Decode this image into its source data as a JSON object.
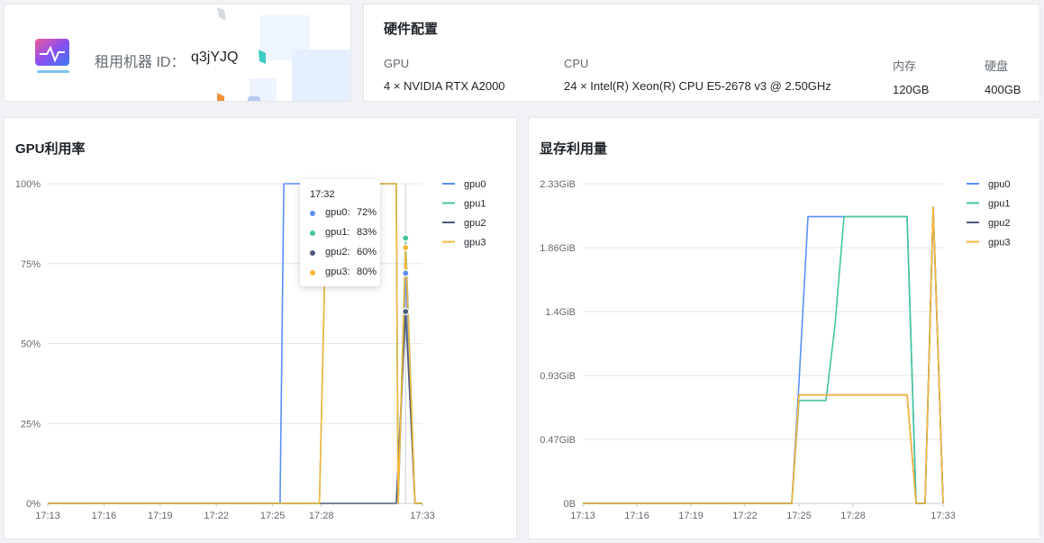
{
  "machine": {
    "label": "租用机器 ID：",
    "id": "q3jYJQ"
  },
  "hardware": {
    "title": "硬件配置",
    "columns": [
      {
        "label": "GPU",
        "value": "4 × NVIDIA RTX A2000"
      },
      {
        "label": "CPU",
        "value": "24 × Intel(R) Xeon(R) CPU E5-2678 v3 @ 2.50GHz"
      },
      {
        "label": "内存",
        "value": "120GB"
      },
      {
        "label": "硬盘",
        "value": "400GB"
      }
    ]
  },
  "colors": {
    "gpu0": "#5b8ff9",
    "gpu1": "#45c69c",
    "gpu2": "#4e5a7a",
    "gpu3": "#f6b83a"
  },
  "tooltip": {
    "time": "17:32",
    "rows": [
      {
        "name": "gpu0:",
        "value": "72%"
      },
      {
        "name": "gpu1:",
        "value": "83%"
      },
      {
        "name": "gpu2:",
        "value": "60%"
      },
      {
        "name": "gpu3:",
        "value": "80%"
      }
    ]
  },
  "chart_data": [
    {
      "type": "line",
      "title": "GPU利用率",
      "x_ticks": [
        "17:13",
        "17:16",
        "17:19",
        "17:22",
        "17:25",
        "17:28",
        "17:33"
      ],
      "y_ticks": [
        "0%",
        "25%",
        "50%",
        "75%",
        "100%"
      ],
      "ylim": [
        0,
        100
      ],
      "xlim": [
        0,
        20
      ],
      "grid": true,
      "legend": "top-right",
      "series": [
        {
          "name": "gpu0",
          "x": [
            0,
            12.4,
            12.6,
            13.8,
            14.0,
            15.5,
            18.6,
            18.7,
            19.1,
            19.6,
            20.0
          ],
          "y": [
            0,
            0,
            100,
            100,
            100,
            100,
            100,
            0,
            72,
            0,
            0
          ]
        },
        {
          "name": "gpu1",
          "x": [
            0,
            14.5,
            14.9,
            18.6,
            18.7,
            19.1,
            19.6,
            20.0
          ],
          "y": [
            0,
            0,
            100,
            100,
            0,
            83,
            0,
            0
          ]
        },
        {
          "name": "gpu2",
          "x": [
            0,
            14.5,
            18.6,
            19.1,
            19.6,
            20.0
          ],
          "y": [
            0,
            0,
            0,
            60,
            0,
            0
          ]
        },
        {
          "name": "gpu3",
          "x": [
            0,
            14.5,
            14.9,
            18.6,
            18.7,
            19.1,
            19.6,
            20.0
          ],
          "y": [
            0,
            0,
            100,
            100,
            0,
            80,
            0,
            0
          ]
        }
      ]
    },
    {
      "type": "line",
      "title": "显存利用量",
      "x_ticks": [
        "17:13",
        "17:16",
        "17:19",
        "17:22",
        "17:25",
        "17:28",
        "17:33"
      ],
      "y_ticks": [
        "0B",
        "0.47GiB",
        "0.93GiB",
        "1.4GiB",
        "1.86GiB",
        "2.33GiB"
      ],
      "ylim": [
        0,
        2.33
      ],
      "xlim": [
        0,
        20
      ],
      "grid": true,
      "legend": "top-right",
      "series": [
        {
          "name": "gpu0",
          "x": [
            0,
            11.6,
            12.0,
            12.5,
            18.0,
            18.5,
            19.0,
            19.45,
            20.0
          ],
          "y": [
            0,
            0,
            0.88,
            2.09,
            2.09,
            0,
            0,
            2.16,
            0
          ]
        },
        {
          "name": "gpu1",
          "x": [
            0,
            11.6,
            12.0,
            13.5,
            14.0,
            14.5,
            18.0,
            18.5,
            19.0,
            19.45,
            20.0
          ],
          "y": [
            0,
            0,
            0.75,
            0.75,
            1.3,
            2.09,
            2.09,
            0,
            0,
            2.16,
            0
          ]
        },
        {
          "name": "gpu2",
          "x": [
            0,
            11.6,
            12.0,
            18.0,
            18.5,
            19.0,
            19.45,
            20.0
          ],
          "y": [
            0,
            0,
            0.79,
            0.79,
            0,
            0,
            2.16,
            0
          ]
        },
        {
          "name": "gpu3",
          "x": [
            0,
            11.6,
            12.0,
            18.0,
            18.5,
            19.0,
            19.45,
            20.0
          ],
          "y": [
            0,
            0,
            0.79,
            0.79,
            0,
            0,
            2.16,
            0
          ]
        }
      ]
    }
  ]
}
